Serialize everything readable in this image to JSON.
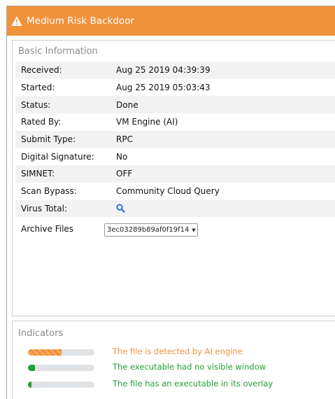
{
  "header": {
    "title": "Medium Risk Backdoor",
    "icon": "warning-icon",
    "color": "#f0923a"
  },
  "basic": {
    "section_title": "Basic Information",
    "rows": [
      {
        "label": "Received:",
        "value": "Aug 25 2019 04:39:39"
      },
      {
        "label": "Started:",
        "value": "Aug 25 2019 05:03:43"
      },
      {
        "label": "Status:",
        "value": "Done"
      },
      {
        "label": "Rated By:",
        "value": "VM Engine (AI)"
      },
      {
        "label": "Submit Type:",
        "value": "RPC"
      },
      {
        "label": "Digital Signature:",
        "value": "No"
      },
      {
        "label": "SIMNET:",
        "value": "OFF"
      },
      {
        "label": "Scan Bypass:",
        "value": "Community Cloud Query"
      },
      {
        "label": "Virus Total:",
        "value": "",
        "icon": "search-icon"
      }
    ],
    "archive": {
      "label": "Archive Files",
      "selected": "3ec03289b89af0f19f14"
    }
  },
  "indicators": {
    "section_title": "Indicators",
    "items": [
      {
        "text": "The file is detected by AI engine",
        "level": 0.5,
        "color": "#f0923a"
      },
      {
        "text": "The executable had no visible window",
        "level": 0.1,
        "color": "#1fa031"
      },
      {
        "text": "The file has an executable in its overlay",
        "level": 0.05,
        "color": "#1fa031"
      }
    ]
  }
}
